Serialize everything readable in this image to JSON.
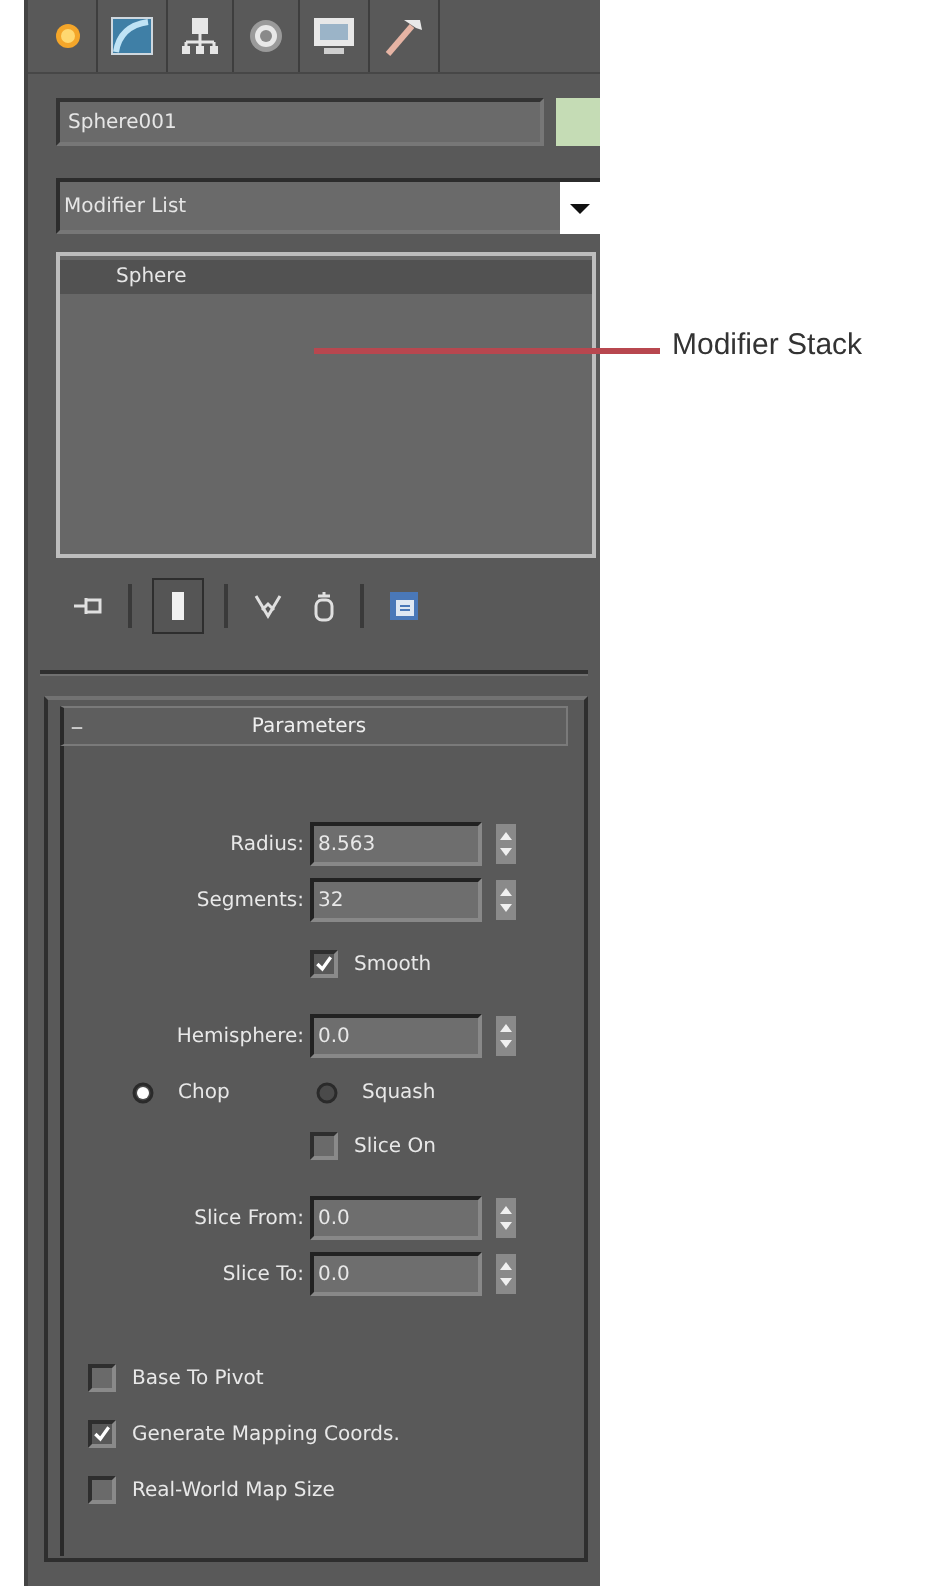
{
  "tabs": [
    {
      "kind": "create"
    },
    {
      "kind": "modify"
    },
    {
      "kind": "hierarchy"
    },
    {
      "kind": "motion"
    },
    {
      "kind": "display"
    },
    {
      "kind": "utilities"
    }
  ],
  "object": {
    "name": "Sphere001",
    "color": "#c5dcb5"
  },
  "modifier_list": {
    "value": "Modifier List"
  },
  "stack": {
    "items": [
      {
        "label": "Sphere",
        "selected": true
      }
    ]
  },
  "stack_toolbar": [
    {
      "kind": "pin",
      "pressed": false
    },
    {
      "kind": "separator"
    },
    {
      "kind": "show-end",
      "pressed": true
    },
    {
      "kind": "separator"
    },
    {
      "kind": "unique",
      "pressed": false
    },
    {
      "kind": "remove",
      "pressed": false
    },
    {
      "kind": "separator"
    },
    {
      "kind": "configure",
      "pressed": false
    }
  ],
  "rollout": {
    "collapse": "_",
    "title": "Parameters",
    "expanded": true,
    "controls": [
      {
        "kind": "spinner",
        "label": "Radius:",
        "value": "8.563"
      },
      {
        "kind": "spinner",
        "label": "Segments:",
        "value": "32"
      },
      {
        "kind": "checkbox",
        "label": "Smooth",
        "checked": true
      },
      {
        "kind": "spinner",
        "label": "Hemisphere:",
        "value": "0.0"
      },
      {
        "kind": "radios",
        "options": [
          {
            "label": "Chop",
            "selected": true
          },
          {
            "label": "Squash",
            "selected": false
          }
        ]
      },
      {
        "kind": "checkbox",
        "label": "Slice On",
        "checked": false
      },
      {
        "kind": "spinner",
        "label": "Slice From:",
        "value": "0.0"
      },
      {
        "kind": "spinner",
        "label": "Slice To:",
        "value": "0.0"
      }
    ],
    "options": [
      {
        "label": "Base To Pivot",
        "checked": false
      },
      {
        "label": "Generate Mapping Coords.",
        "checked": true
      },
      {
        "label": "Real-World Map Size",
        "checked": false
      }
    ]
  },
  "callout": {
    "label": "Modifier Stack"
  }
}
